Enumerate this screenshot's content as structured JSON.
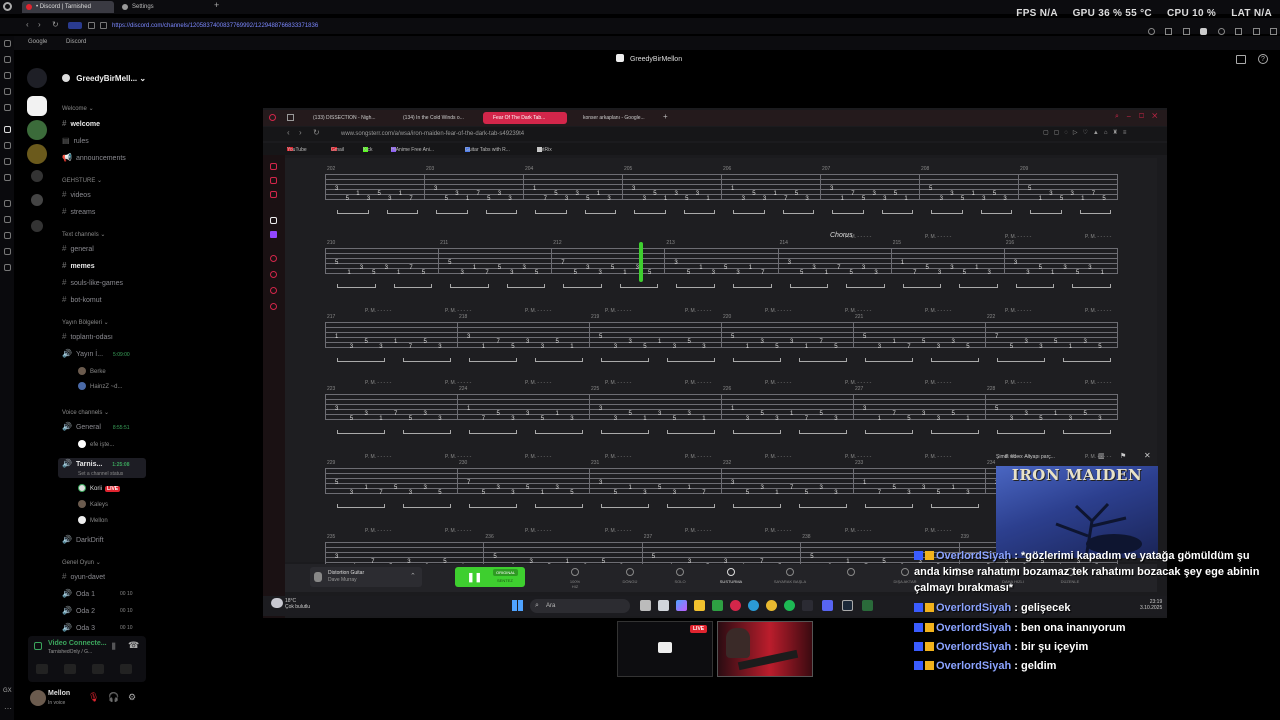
{
  "browser": {
    "tabs": [
      {
        "label": "• Discord | Tarnished",
        "active": true
      },
      {
        "label": "Settings",
        "active": false
      }
    ],
    "url": "https://discord.com/channels/1205837400837769992/1229488766833371836",
    "bookmarks": [
      "Google",
      "Discord"
    ]
  },
  "stats": {
    "fps": "FPS N/A",
    "gpu": "GPU 36 % 55 °C",
    "cpu": "CPU 10 %",
    "lat": "LAT N/A"
  },
  "discord": {
    "server_name": "GreedyBirMell...",
    "stream_owner": "GreedyBirMellon",
    "channels": {
      "welcome_cat": "Welcome",
      "welcome": "welcome",
      "rules": "rules",
      "announcements": "announcements",
      "gehsture_cat": "GEHSTURE",
      "videos": "videos",
      "streams": "streams",
      "text_cat": "Text channels",
      "general": "general",
      "memes": "memes",
      "souls": "souls-like-games",
      "botkomut": "bot-komut",
      "yayin_cat": "Yayın Bölgeleri",
      "toplanti": "toplantı-odası",
      "yayin": "Yayın İ...",
      "yayin_time": "5:09:00",
      "yayin_users": [
        "Berke",
        "HainzZ ~d..."
      ],
      "voice_cat": "Voice channels",
      "v_general": "General",
      "v_general_time": "8:55:51",
      "v_general_users": [
        "efe işte..."
      ],
      "tarnished": "Tarnis...",
      "tarnished_time": "1:25:08",
      "tarnished_status": "Set a channel status",
      "tarnished_users": [
        "Korii",
        "Kaleys",
        "Mellon"
      ],
      "live_label": "LIVE",
      "darkdrift": "DarkDrift",
      "genel_cat": "Genel Oyun",
      "oyun_davet": "oyun-davet",
      "oda1": "Oda 1",
      "oda2": "Oda 2",
      "oda3": "Oda 3",
      "oda_count": "00",
      "oda_limit": "10"
    },
    "voice_panel": {
      "title": "Video Connecte...",
      "subtitle": "TarnishedOnly / G..."
    },
    "user": {
      "name": "Mellon",
      "status": "In voice"
    }
  },
  "shared_screen": {
    "tabs": [
      {
        "label": "(133) DISSECTION - Nigh...",
        "active": false
      },
      {
        "label": "(134) In the Cold Winds o...",
        "active": false
      },
      {
        "label": "Fear Of The Dark Tab...",
        "active": true
      },
      {
        "label": "konser arkaplanı - Google...",
        "active": false
      }
    ],
    "url": "www.songsterr.com/a/wsa/iron-maiden-fear-of-the-dark-tab-s49239t4",
    "bookmarks": [
      "YouTube",
      "Gmail",
      "Kick",
      "HiAnime Free Ani...",
      "Guitar Tabs with R...",
      "BotRix"
    ],
    "section_label": "Chorus",
    "pm_label": "P. M.",
    "measure_rows": [
      [
        "202",
        "203",
        "204",
        "205",
        "206",
        "207",
        "208",
        "209"
      ],
      [
        "210",
        "211",
        "212",
        "213",
        "214",
        "215",
        "216"
      ],
      [
        "217",
        "218",
        "219",
        "220",
        "221",
        "222"
      ],
      [
        "223",
        "224",
        "225",
        "226",
        "227",
        "228"
      ],
      [
        "229",
        "230",
        "231",
        "232",
        "233",
        "234"
      ],
      [
        "235",
        "236",
        "237",
        "238",
        "239"
      ]
    ],
    "player": {
      "instrument": "Distortion Guitar",
      "artist": "Dave Murray",
      "original": "ORIGINAL",
      "sentez": "SENTEZ",
      "speed": "100%",
      "controls": [
        "HIZ",
        "DÖNGÜ",
        "SOLO",
        "SUSTURMA",
        "SAYARAK BAŞLA",
        "",
        "DIŞA AKTAR",
        "",
        "DAHA HIZLI",
        "DÜZENLE"
      ]
    },
    "taskbar": {
      "search": "Ara",
      "weather_temp": "18°C",
      "weather_text": "Çok bulutlu",
      "time": "23:19",
      "date": "3.10.2025"
    }
  },
  "overlay_song": {
    "header": "Şimdi video: Altyapı parç...",
    "logo": "IRON MAIDEN"
  },
  "chat": [
    {
      "user": "OverlordSiyah",
      "text": " : *gözlerimi kapadım ve yatağa gömüldüm şu anda kimse rahatımı bozamaz tek rahatımı bozacak şey ege abinin çalmayı bırakması*"
    },
    {
      "user": "OverlordSiyah",
      "text": " : gelişecek"
    },
    {
      "user": "OverlordSiyah",
      "text": " : ben ona inanıyorum"
    },
    {
      "user": "OverlordSiyah",
      "text": " : bir şu içeyim"
    },
    {
      "user": "OverlordSiyah",
      "text": " : geldim"
    }
  ],
  "cam_live": "LIVE"
}
